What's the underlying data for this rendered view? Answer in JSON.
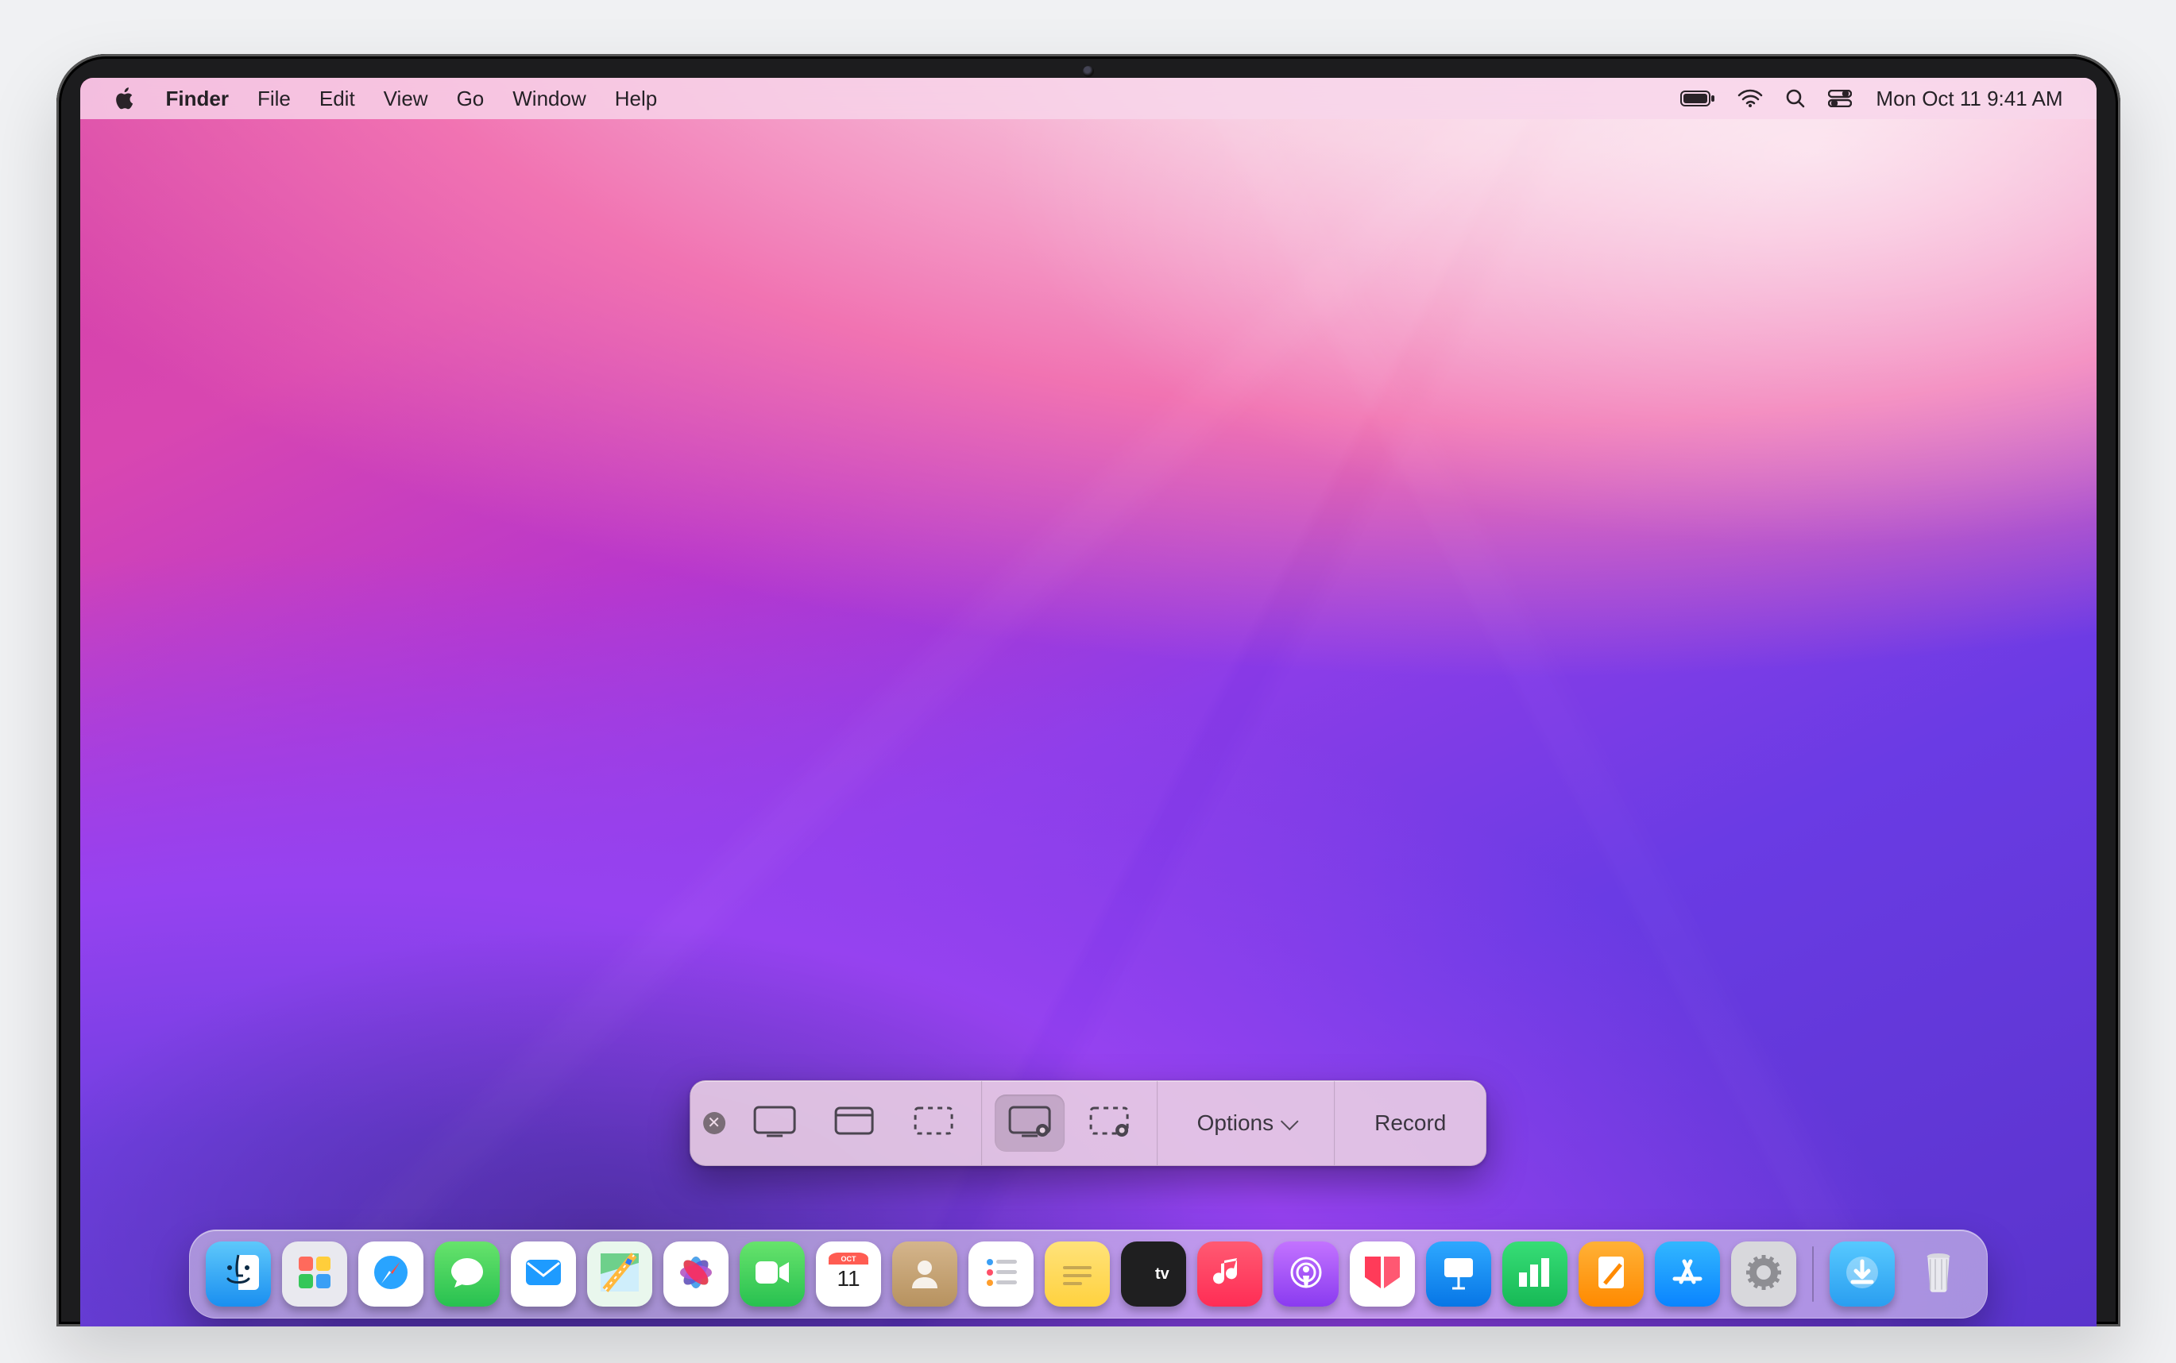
{
  "menubar": {
    "app": "Finder",
    "items": [
      "File",
      "Edit",
      "View",
      "Go",
      "Window",
      "Help"
    ],
    "clock": "Mon Oct 11  9:41 AM"
  },
  "screenshot_toolbar": {
    "options_label": "Options",
    "action_label": "Record",
    "buttons": [
      {
        "id": "capture-entire-screen",
        "selected": false
      },
      {
        "id": "capture-window",
        "selected": false
      },
      {
        "id": "capture-selection",
        "selected": false
      },
      {
        "id": "record-entire-screen",
        "selected": true
      },
      {
        "id": "record-selection",
        "selected": false
      }
    ]
  },
  "dock": {
    "apps": [
      {
        "id": "finder",
        "label": "Finder",
        "bg": "linear-gradient(180deg,#5ec8fb,#1a8ff0)"
      },
      {
        "id": "launchpad",
        "label": "Launchpad",
        "bg": "#e9e9ef"
      },
      {
        "id": "safari",
        "label": "Safari",
        "bg": "#ffffff"
      },
      {
        "id": "messages",
        "label": "Messages",
        "bg": "linear-gradient(180deg,#67e36c,#28c150)"
      },
      {
        "id": "mail",
        "label": "Mail",
        "bg": "#ffffff"
      },
      {
        "id": "maps",
        "label": "Maps",
        "bg": "#e9f7ed"
      },
      {
        "id": "photos",
        "label": "Photos",
        "bg": "#ffffff"
      },
      {
        "id": "facetime",
        "label": "FaceTime",
        "bg": "linear-gradient(180deg,#67e36c,#28c150)"
      },
      {
        "id": "calendar",
        "label": "Calendar",
        "bg": "#ffffff",
        "meta": {
          "month": "OCT",
          "day": "11"
        }
      },
      {
        "id": "contacts",
        "label": "Contacts",
        "bg": "linear-gradient(180deg,#d4b58c,#b7925f)"
      },
      {
        "id": "reminders",
        "label": "Reminders",
        "bg": "#ffffff"
      },
      {
        "id": "notes",
        "label": "Notes",
        "bg": "linear-gradient(180deg,#ffe27a,#ffd23f)"
      },
      {
        "id": "appletv",
        "label": "Apple TV",
        "bg": "#1f1f20"
      },
      {
        "id": "music",
        "label": "Music",
        "bg": "linear-gradient(180deg,#ff5a72,#ff2d55)"
      },
      {
        "id": "podcasts",
        "label": "Podcasts",
        "bg": "linear-gradient(180deg,#c373ff,#8a3bf0)"
      },
      {
        "id": "news",
        "label": "News",
        "bg": "#ffffff"
      },
      {
        "id": "keynote",
        "label": "Keynote",
        "bg": "linear-gradient(180deg,#2ea8ff,#0776e6)"
      },
      {
        "id": "numbers",
        "label": "Numbers",
        "bg": "linear-gradient(180deg,#37dd76,#17b956)"
      },
      {
        "id": "pages",
        "label": "Pages",
        "bg": "linear-gradient(180deg,#ffb137,#ff8a00)"
      },
      {
        "id": "appstore",
        "label": "App Store",
        "bg": "linear-gradient(180deg,#32b7ff,#0a84ff)"
      },
      {
        "id": "settings",
        "label": "System Preferences",
        "bg": "#d8d8dc"
      }
    ],
    "right": [
      {
        "id": "downloads",
        "label": "Downloads",
        "bg": "linear-gradient(180deg,#57c9ff,#2a9ef0)"
      },
      {
        "id": "trash",
        "label": "Trash"
      }
    ]
  }
}
